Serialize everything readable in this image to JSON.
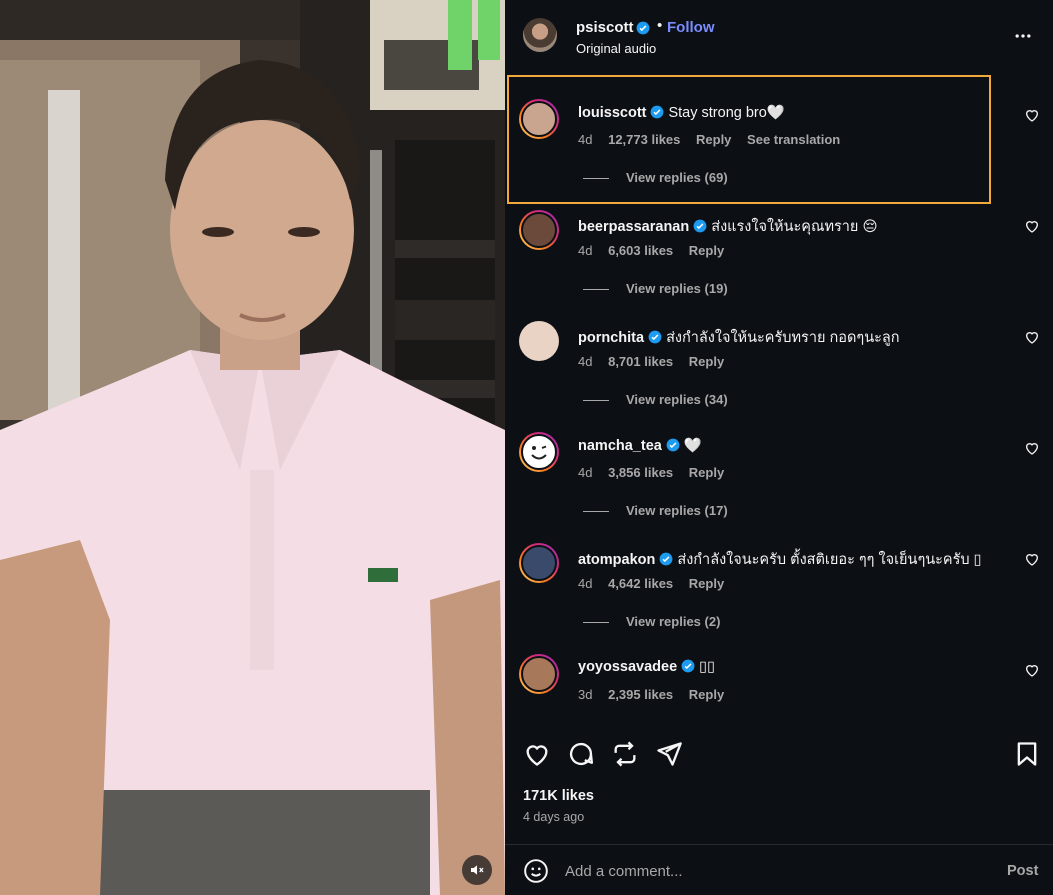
{
  "post": {
    "author": "psiscott",
    "follow_label": "Follow",
    "dot": "•",
    "audio": "Original audio"
  },
  "comments": [
    {
      "user": "louisscott",
      "text": "Stay strong bro",
      "emoji": "🤍",
      "age": "4d",
      "likes": "12,773 likes",
      "reply": "Reply",
      "translate": "See translation",
      "replies": "View replies (69)",
      "avatar_color": "#c9a58f"
    },
    {
      "user": "beerpassaranan",
      "text": "ส่งแรงใจให้นะคุณทราย",
      "emoji": "😔",
      "age": "4d",
      "likes": "6,603 likes",
      "reply": "Reply",
      "replies": "View replies (19)",
      "avatar_color": "#6b4a3c"
    },
    {
      "user": "pornchita",
      "text": "ส่งกำลังใจให้นะครับทราย กอดๆนะลูก",
      "age": "4d",
      "likes": "8,701 likes",
      "reply": "Reply",
      "replies": "View replies (34)",
      "avatar_color": "#e9d3c4"
    },
    {
      "user": "namcha_tea",
      "text": "",
      "emoji": "🤍",
      "age": "4d",
      "likes": "3,856 likes",
      "reply": "Reply",
      "replies": "View replies (17)",
      "avatar_color": "#ffffff"
    },
    {
      "user": "atompakon",
      "text": "ส่งกำลังใจนะครับ ตั้งสติเยอะ ๆๆ ใจเย็นๆนะครับ",
      "emoji": "▯",
      "age": "4d",
      "likes": "4,642 likes",
      "reply": "Reply",
      "replies": "View replies (2)",
      "avatar_color": "#3a4a6b"
    },
    {
      "user": "yoyossavadee",
      "text": "▯▯",
      "age": "3d",
      "likes": "2,395 likes",
      "reply": "Reply",
      "avatar_color": "#a8785a"
    }
  ],
  "footer": {
    "likes": "171K likes",
    "ago": "4 days ago",
    "comment_placeholder": "Add a comment...",
    "post_label": "Post"
  },
  "colors": {
    "panel_bg": "#0c0f14",
    "accent_link": "#7b8cff",
    "verified": "#1d9bf0",
    "highlight_border": "#f2a93b"
  }
}
